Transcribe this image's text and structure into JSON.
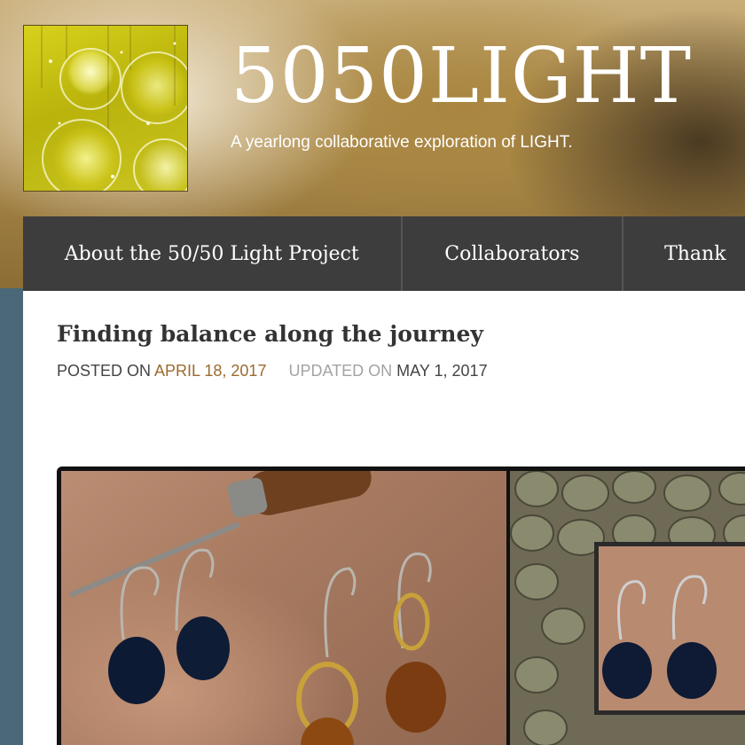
{
  "site": {
    "title": "5050LIGHT",
    "tagline": "A yearlong collaborative exploration of LIGHT."
  },
  "nav": {
    "items": [
      {
        "label": "About the 50/50 Light Project"
      },
      {
        "label": "Collaborators"
      },
      {
        "label": "Thank"
      }
    ]
  },
  "post": {
    "title": "Finding balance along the journey",
    "posted_label": "POSTED ON",
    "posted_date": "APRIL 18, 2017",
    "updated_label": "UPDATED ON",
    "updated_date": "MAY 1, 2017",
    "image_subject": "earrings-photo"
  },
  "colors": {
    "nav_bg": "#3d3d3d",
    "link": "#9b6a2e",
    "side_strip": "#4a6878"
  }
}
